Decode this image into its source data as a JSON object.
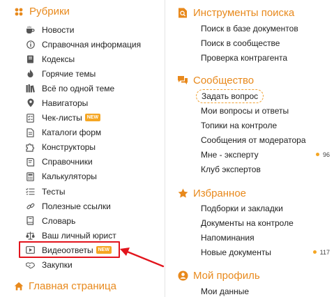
{
  "left": {
    "rubrics_title": "Рубрики",
    "items": [
      {
        "label": "Новости",
        "icon": "coffee-cup-icon"
      },
      {
        "label": "Справочная информация",
        "icon": "info-circle-icon"
      },
      {
        "label": "Кодексы",
        "icon": "codex-book-icon"
      },
      {
        "label": "Горячие темы",
        "icon": "flame-icon"
      },
      {
        "label": "Всё по одной теме",
        "icon": "books-stack-icon"
      },
      {
        "label": "Навигаторы",
        "icon": "map-pin-icon"
      },
      {
        "label": "Чек-листы",
        "icon": "checklist-icon",
        "badge": "NEW"
      },
      {
        "label": "Каталоги форм",
        "icon": "form-catalog-icon"
      },
      {
        "label": "Конструкторы",
        "icon": "puzzle-icon"
      },
      {
        "label": "Справочники",
        "icon": "reference-book-icon"
      },
      {
        "label": "Калькуляторы",
        "icon": "calculator-icon"
      },
      {
        "label": "Тесты",
        "icon": "test-list-icon"
      },
      {
        "label": "Полезные ссылки",
        "icon": "link-icon"
      },
      {
        "label": "Словарь",
        "icon": "dictionary-icon"
      },
      {
        "label": "Ваш личный юрист",
        "icon": "scales-icon"
      },
      {
        "label": "Видеоответы",
        "icon": "video-play-icon",
        "badge": "NEW"
      },
      {
        "label": "Закупки",
        "icon": "handshake-icon"
      }
    ],
    "home_title": "Главная страница"
  },
  "right": {
    "search": {
      "title": "Инструменты поиска",
      "items": [
        {
          "label": "Поиск в базе документов"
        },
        {
          "label": "Поиск в сообществе"
        },
        {
          "label": "Проверка контрагента"
        }
      ]
    },
    "community": {
      "title": "Сообщество",
      "ask_label": "Задать вопрос",
      "items": [
        {
          "label": "Мои вопросы и ответы"
        },
        {
          "label": "Топики на контроле"
        },
        {
          "label": "Сообщения от модератора"
        },
        {
          "label": "Мне - эксперту",
          "count": "96"
        },
        {
          "label": "Клуб экспертов"
        }
      ]
    },
    "favorites": {
      "title": "Избранное",
      "items": [
        {
          "label": "Подборки и закладки"
        },
        {
          "label": "Документы на контроле"
        },
        {
          "label": "Напоминания"
        },
        {
          "label": "Новые документы",
          "count": "117"
        }
      ]
    },
    "profile": {
      "title": "Мой профиль",
      "items": [
        {
          "label": "Мои данные"
        }
      ]
    }
  },
  "colors": {
    "accent": "#e8891c",
    "badge": "#f5a623",
    "highlight": "#e2141c"
  }
}
